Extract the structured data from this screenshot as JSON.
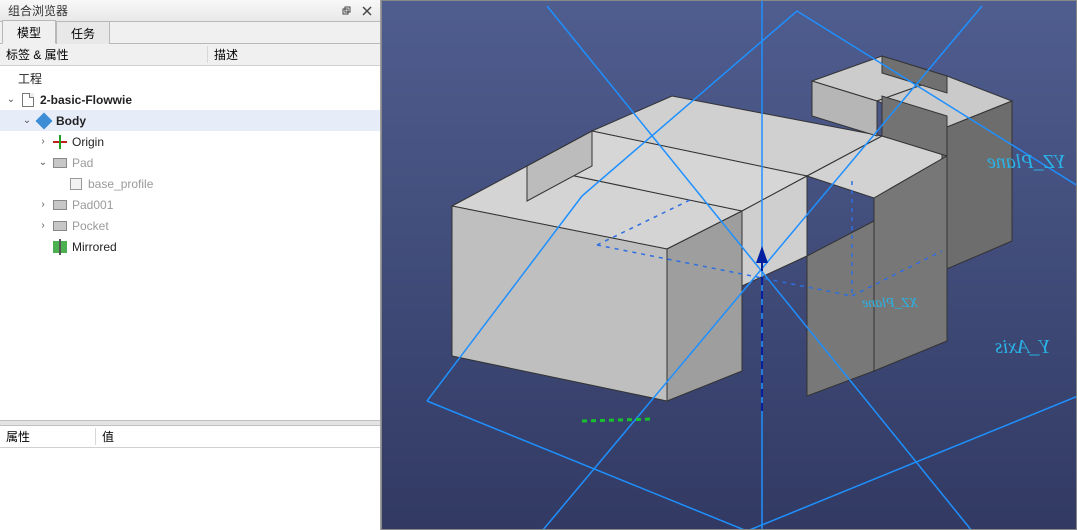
{
  "panel": {
    "title": "组合浏览器",
    "tabs": {
      "model": "模型",
      "tasks": "任务"
    },
    "columns": {
      "label": "标签 & 属性",
      "descr": "描述"
    },
    "root": "工程"
  },
  "tree": {
    "file": "2-basic-Flowwie",
    "body": "Body",
    "origin": "Origin",
    "pad": "Pad",
    "base_profile": "base_profile",
    "pad001": "Pad001",
    "pocket": "Pocket",
    "mirrored": "Mirrored"
  },
  "props": {
    "col1": "属性",
    "col2": "值"
  },
  "viewport": {
    "plane_yz": "YZ_Plane",
    "plane_xz": "XZ_Plane",
    "axis_y": "Y_Axis"
  }
}
